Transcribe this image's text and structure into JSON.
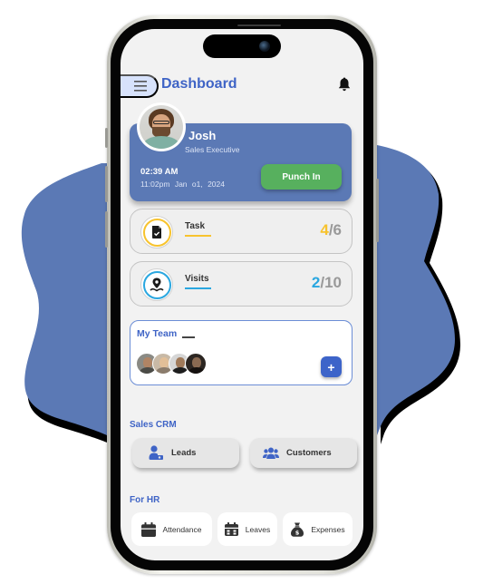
{
  "header": {
    "title": "Dashboard",
    "menu_icon": "hamburger-menu-icon",
    "notification_icon": "bell-icon"
  },
  "profile": {
    "name": "Josh",
    "role": "Sales Executive",
    "current_time": "02:39 AM",
    "last_time": "11:02pm",
    "last_date": "Jan o1, 2024",
    "punch_label": "Punch In"
  },
  "stats": [
    {
      "label": "Task",
      "done": "4",
      "total": "/6",
      "icon": "task-document-check-icon",
      "accent": "#f7c32e"
    },
    {
      "label": "Visits",
      "done": "2",
      "total": "/10",
      "icon": "location-pin-icon",
      "accent": "#2aa7e0"
    }
  ],
  "team": {
    "title": "My Team",
    "member_count_shown": 4,
    "add_label": "+"
  },
  "sales_crm": {
    "title": "Sales CRM",
    "items": [
      {
        "label": "Leads",
        "icon": "lead-user-icon"
      },
      {
        "label": "Customers",
        "icon": "users-group-icon"
      }
    ]
  },
  "hr": {
    "title": "For HR",
    "items": [
      {
        "label": "Attendance",
        "icon": "calendar-icon"
      },
      {
        "label": "Leaves",
        "icon": "calendar-week-icon"
      },
      {
        "label": "Expenses",
        "icon": "money-bag-icon"
      }
    ]
  },
  "colors": {
    "brand": "#3f64c6",
    "card": "#5b79b5",
    "punch": "#57b05e",
    "blob": "#5b79b5"
  }
}
